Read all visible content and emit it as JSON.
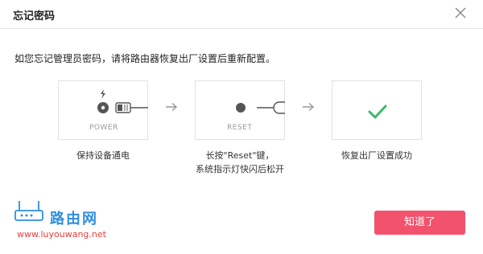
{
  "dialog": {
    "title": "忘记密码",
    "instruction": "如您忘记管理员密码，请将路由器恢复出厂设置后重新配置。"
  },
  "steps": [
    {
      "device_label": "POWER",
      "caption": "保持设备通电"
    },
    {
      "device_label": "RESET",
      "caption_line1": "长按\"Reset\"键，",
      "caption_line2": "系统指示灯快闪后松开"
    },
    {
      "caption": "恢复出厂设置成功"
    }
  ],
  "footer": {
    "logo_text": "路由网",
    "logo_url": "www.luyouwang.net",
    "confirm_label": "知道了"
  },
  "colors": {
    "accent": "#f2526c",
    "success": "#3cba6b",
    "logo_blue": "#2f8fe0",
    "logo_red": "#e83e3e"
  }
}
